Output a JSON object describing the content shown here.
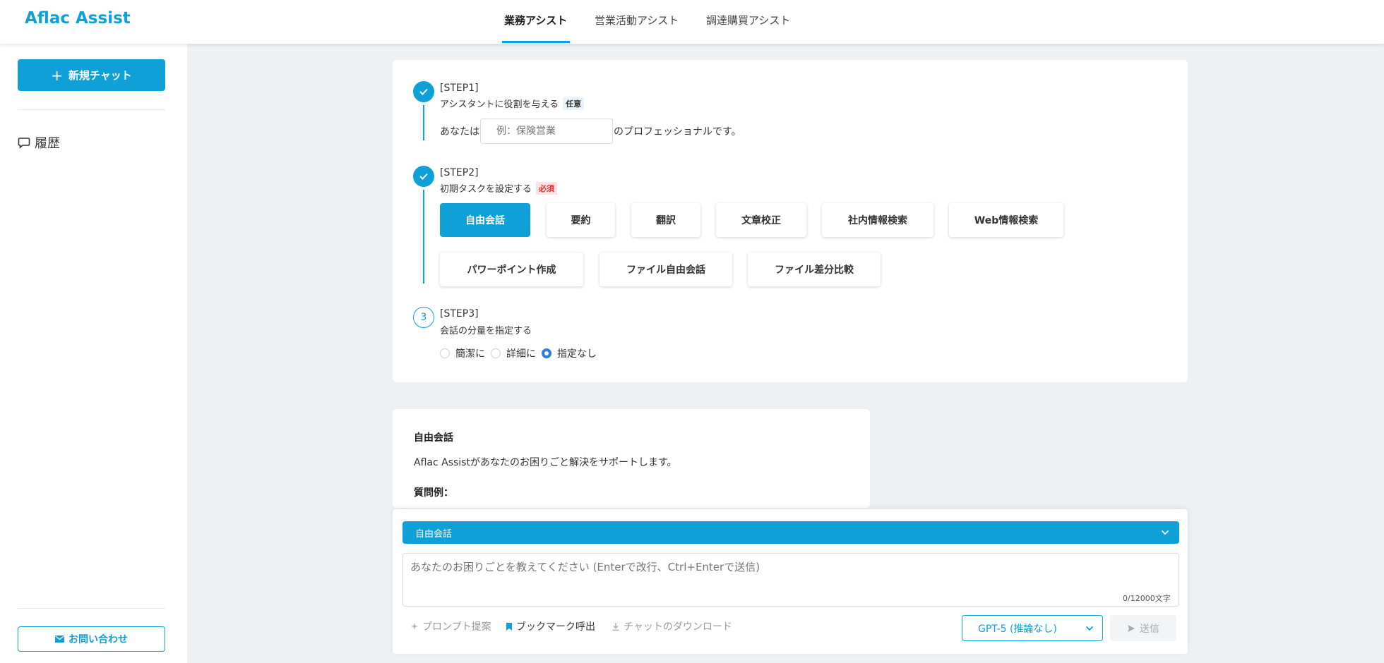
{
  "app": {
    "brand": "Aflac Assist"
  },
  "nav": {
    "tabs": [
      "業務アシスト",
      "営業活動アシスト",
      "調達購買アシスト"
    ],
    "active_tab": "業務アシスト"
  },
  "sidebar": {
    "new_chat_label": "新規チャット",
    "history_label": "履歴",
    "contact_label": "お問い合わせ"
  },
  "steps": {
    "step1": {
      "title": "[STEP1]",
      "subtitle": "アシスタントに役割を与える",
      "badge": "任意",
      "prefix": "あなたは",
      "placeholder": "例：保険営業",
      "suffix": "のプロフェッショナルです。"
    },
    "step2": {
      "title": "[STEP2]",
      "subtitle": "初期タスクを設定する",
      "badge": "必須",
      "tasks": [
        "自由会話",
        "要約",
        "翻訳",
        "文章校正",
        "社内情報検索",
        "Web情報検索",
        "パワーポイント作成",
        "ファイル自由会話",
        "ファイル差分比較"
      ],
      "active_task": "自由会話"
    },
    "step3": {
      "number": "3",
      "title": "[STEP3]",
      "subtitle": "会話の分量を指定する",
      "options": [
        "簡潔に",
        "詳細に",
        "指定なし"
      ],
      "selected": "指定なし"
    }
  },
  "description": {
    "title": "自由会話",
    "text": "Aflac Assistがあなたのお困りごと解決をサポートします。",
    "examples_label": "質問例："
  },
  "composer": {
    "mode": "自由会話",
    "placeholder": "あなたのお困りごとを教えてください (Enterで改行、Ctrl+Enterで送信)",
    "char_count": "0/12000文字",
    "tools": [
      "プロンプト提案",
      "ブックマーク呼出",
      "チャットのダウンロード"
    ],
    "model": "GPT-5 (推論なし)",
    "send_label": "送信"
  },
  "colors": {
    "accent": "#0fa0d8",
    "radio_checked": "#2f7fd6",
    "required_badge": "#d33"
  },
  "icons": [
    "plus-icon",
    "chat-bubble-icon",
    "mail-icon",
    "check-icon",
    "chevron-down-icon",
    "sparkle-icon",
    "bookmark-icon",
    "download-icon",
    "send-icon"
  ]
}
